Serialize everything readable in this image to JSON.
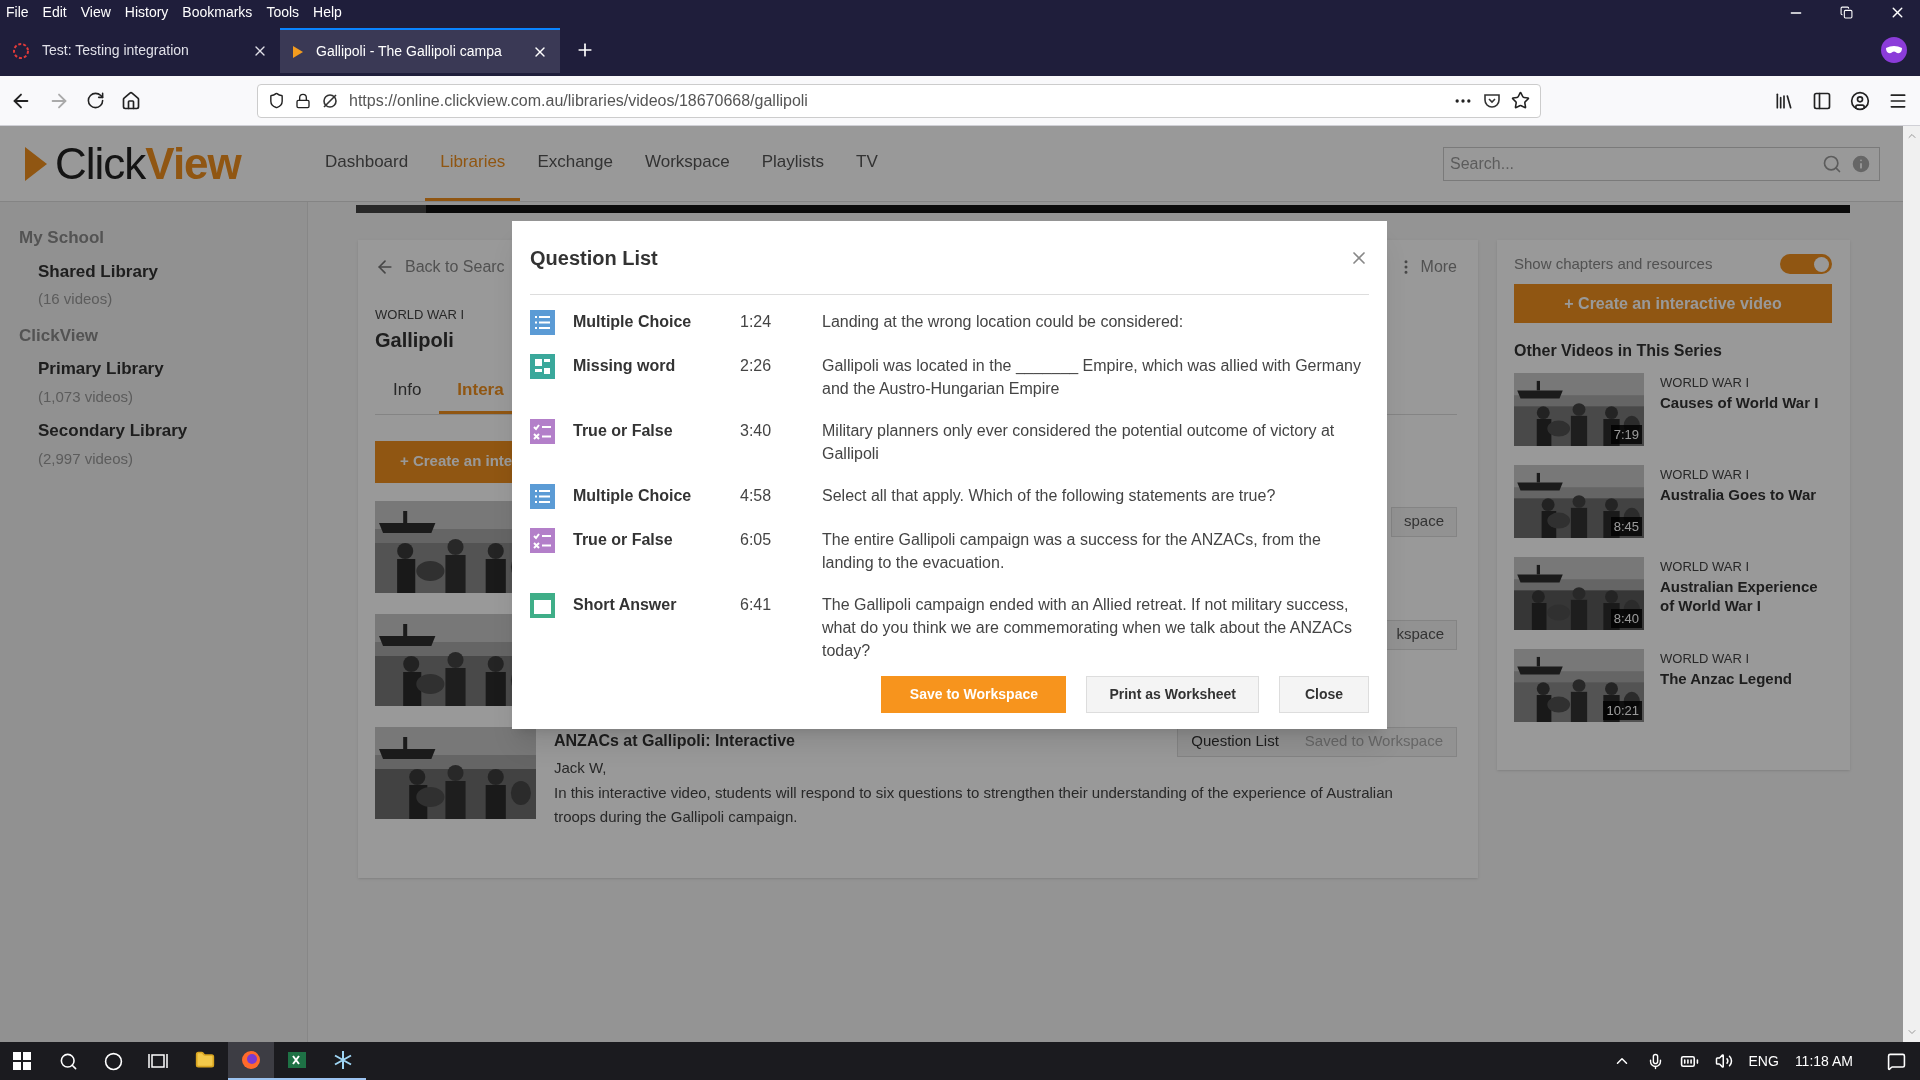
{
  "browser": {
    "menu": [
      "File",
      "Edit",
      "View",
      "History",
      "Bookmarks",
      "Tools",
      "Help"
    ],
    "tabs": [
      {
        "title": "Test: Testing integration",
        "kind": "loading",
        "selected": false
      },
      {
        "title": "Gallipoli - The Gallipoli campa",
        "kind": "play",
        "selected": true
      }
    ],
    "url": "https://online.clickview.com.au/libraries/videos/18670668/gallipoli"
  },
  "header": {
    "logo": {
      "first": "Click",
      "second": "View"
    },
    "nav": [
      {
        "label": "Dashboard",
        "selected": false
      },
      {
        "label": "Libraries",
        "selected": true
      },
      {
        "label": "Exchange",
        "selected": false
      },
      {
        "label": "Workspace",
        "selected": false
      },
      {
        "label": "Playlists",
        "selected": false
      },
      {
        "label": "TV",
        "selected": false
      }
    ],
    "search": {
      "placeholder": "Search..."
    }
  },
  "sidebar": {
    "sections": [
      {
        "title": "My School",
        "items": [
          {
            "name": "Shared Library",
            "count": "(16 videos)"
          }
        ]
      },
      {
        "title": "ClickView",
        "items": [
          {
            "name": "Primary Library",
            "count": "(1,073 videos)"
          },
          {
            "name": "Secondary Library",
            "count": "(2,997 videos)"
          }
        ]
      }
    ]
  },
  "content": {
    "back": "Back to Searc",
    "more": "More",
    "series": "WORLD WAR I",
    "title": "Gallipoli",
    "tabs": [
      {
        "label": "Info",
        "selected": false
      },
      {
        "label": "Intera",
        "selected": true
      }
    ],
    "create_button": "+ Create an inte",
    "videos": [
      {
        "kind": "partial",
        "button": "space"
      },
      {
        "kind": "partial",
        "button": "kspace"
      },
      {
        "kind": "full",
        "title": "ANZACs at Gallipoli: Interactive",
        "author": "Jack W,",
        "description": "In this interactive video, students will respond to six questions to strengthen their understanding of the experience of Australian troops during the Gallipoli campaign.",
        "buttons": [
          {
            "label": "Question List",
            "disabled": false
          },
          {
            "label": "Saved to Workspace",
            "disabled": true
          }
        ]
      }
    ]
  },
  "right_panel": {
    "toggle": {
      "label": "Show chapters and resources",
      "on": true
    },
    "create_button": "+ Create an interactive video",
    "heading": "Other Videos in This Series",
    "videos": [
      {
        "series": "WORLD WAR I",
        "title": "Causes of World War I",
        "duration": "7:19"
      },
      {
        "series": "WORLD WAR I",
        "title": "Australia Goes to War",
        "duration": "8:45"
      },
      {
        "series": "WORLD WAR I",
        "title": "Australian Experience of World War I",
        "duration": "8:40"
      },
      {
        "series": "WORLD WAR I",
        "title": "The Anzac Legend",
        "duration": "10:21"
      }
    ]
  },
  "modal": {
    "title": "Question List",
    "questions": [
      {
        "kind": "multiple_choice",
        "type": "Multiple Choice",
        "time": "1:24",
        "text": "Landing at the wrong location could be considered:"
      },
      {
        "kind": "missing_word",
        "type": "Missing word",
        "time": "2:26",
        "text": "Gallipoli was located in the _______ Empire, which was allied with Germany and the Austro-Hungarian Empire"
      },
      {
        "kind": "true_false",
        "type": "True or False",
        "time": "3:40",
        "text": "Military planners only ever considered the potential outcome of victory at Gallipoli"
      },
      {
        "kind": "multiple_choice",
        "type": "Multiple Choice",
        "time": "4:58",
        "text": "Select all that apply. Which of the following statements are true?"
      },
      {
        "kind": "true_false",
        "type": "True or False",
        "time": "6:05",
        "text": "The entire Gallipoli campaign was a success for the ANZACs, from the landing to the evacuation."
      },
      {
        "kind": "short_answer",
        "type": "Short Answer",
        "time": "6:41",
        "text": "The Gallipoli campaign ended with an Allied retreat. If not military success, what do you think we are commemorating when we talk about the ANZACs today?"
      }
    ],
    "buttons": [
      {
        "kind": "primary",
        "label": "Save to Workspace"
      },
      {
        "kind": "default",
        "label": "Print as Worksheet"
      },
      {
        "kind": "default",
        "label": "Close"
      }
    ]
  },
  "taskbar": {
    "apps": [
      {
        "kind": "explorer",
        "open": false,
        "selected": false
      },
      {
        "kind": "firefox",
        "open": true,
        "selected": true
      },
      {
        "kind": "excel",
        "open": true,
        "selected": false
      },
      {
        "kind": "snowflake",
        "open": true,
        "selected": false
      }
    ],
    "language": "ENG",
    "time": "11:18 AM"
  }
}
